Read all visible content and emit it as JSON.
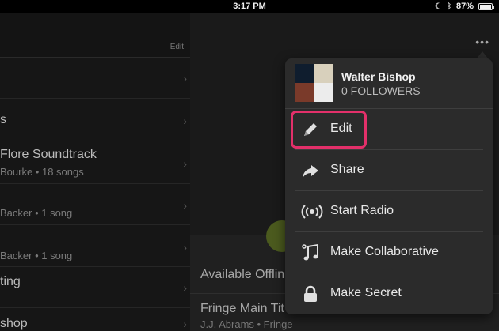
{
  "status_bar": {
    "time": "3:17 PM",
    "battery": "87%"
  },
  "left_pane": {
    "edit_label": "Edit",
    "rows": [
      {
        "title": "",
        "subtitle": ""
      },
      {
        "title": "s",
        "subtitle": ""
      },
      {
        "title": "Flore Soundtrack",
        "subtitle": "Bourke • 18 songs"
      },
      {
        "title": "",
        "subtitle": "Backer • 1 song"
      },
      {
        "title": "",
        "subtitle": "Backer • 1 song"
      },
      {
        "title": "ting",
        "subtitle": ""
      },
      {
        "title": "shop",
        "subtitle": ""
      }
    ]
  },
  "right_pane": {
    "available_label": "Available Offlin",
    "track_title": "Fringe Main Tit",
    "track_artist": "J.J. Abrams • Fringe"
  },
  "popover": {
    "user_name": "Walter Bishop",
    "followers": "0 FOLLOWERS",
    "menu": [
      {
        "label": "Edit",
        "icon": "pencil-icon"
      },
      {
        "label": "Share",
        "icon": "share-arrow-icon"
      },
      {
        "label": "Start Radio",
        "icon": "radio-icon"
      },
      {
        "label": "Make Collaborative",
        "icon": "music-note-icon"
      },
      {
        "label": "Make Secret",
        "icon": "lock-icon"
      }
    ]
  },
  "colors": {
    "highlight": "#e3306a",
    "background": "#0e0e0e",
    "popover": "#2b2b2b"
  }
}
